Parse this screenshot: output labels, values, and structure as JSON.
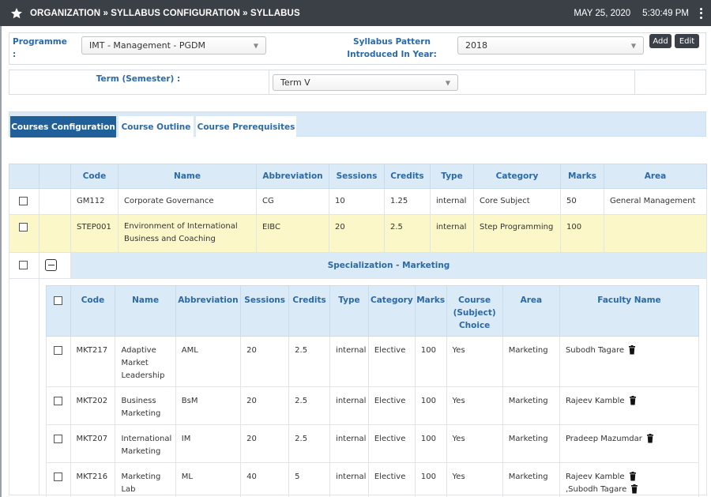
{
  "header": {
    "breadcrumb": "ORGANIZATION » SYLLABUS CONFIGURATION » SYLLABUS",
    "date": "MAY 25, 2020",
    "time": "5:30:49 PM"
  },
  "filters": {
    "programme_label": "Programme :",
    "programme_value": "IMT - Management - PGDM",
    "pattern_label": "Syllabus Pattern Introduced In Year:",
    "pattern_value": "2018",
    "add_label": "Add",
    "edit_label": "Edit",
    "term_label": "Term (Semester) :",
    "term_value": "Term V"
  },
  "tabs": [
    {
      "label": "Courses Configuration"
    },
    {
      "label": "Course Outline"
    },
    {
      "label": "Course Prerequisites"
    }
  ],
  "courses_table": {
    "headers": [
      "Code",
      "Name",
      "Abbreviation",
      "Sessions",
      "Credits",
      "Type",
      "Category",
      "Marks",
      "Area"
    ],
    "rows": [
      [
        "GM112",
        "Corporate Governance",
        "CG",
        "10",
        "1.25",
        "internal",
        "Core Subject",
        "50",
        "General Management"
      ],
      [
        "STEP001",
        "Environment of International Business and Coaching",
        "EIBC",
        "20",
        "2.5",
        "internal",
        "Step Programming",
        "100",
        ""
      ]
    ],
    "specialization_title": "Specialization - Marketing"
  },
  "specialization_table": {
    "headers": [
      "Code",
      "Name",
      "Abbreviation",
      "Sessions",
      "Credits",
      "Type",
      "Category",
      "Marks",
      "Course (Subject) Choice",
      "Area",
      "Faculty Name"
    ],
    "rows": [
      {
        "code": "MKT217",
        "name": "Adaptive Market Leadership",
        "abbr": "AML",
        "sessions": "20",
        "credits": "2.5",
        "type": "internal",
        "category": "Elective",
        "marks": "100",
        "choice": "Yes",
        "area": "Marketing",
        "faculty": [
          "Subodh Tagare"
        ]
      },
      {
        "code": "MKT202",
        "name": "Business Marketing",
        "abbr": "BsM",
        "sessions": "20",
        "credits": "2.5",
        "type": "internal",
        "category": "Elective",
        "marks": "100",
        "choice": "Yes",
        "area": "Marketing",
        "faculty": [
          "Rajeev Kamble"
        ]
      },
      {
        "code": "MKT207",
        "name": "International Marketing",
        "abbr": "IM",
        "sessions": "20",
        "credits": "2.5",
        "type": "internal",
        "category": "Elective",
        "marks": "100",
        "choice": "Yes",
        "area": "Marketing",
        "faculty": [
          "Pradeep Mazumdar"
        ]
      },
      {
        "code": "MKT216",
        "name": "Marketing Lab",
        "abbr": "ML",
        "sessions": "40",
        "credits": "5",
        "type": "internal",
        "category": "Elective",
        "marks": "100",
        "choice": "Yes",
        "area": "Marketing",
        "faculty": [
          "Rajeev Kamble",
          ",Subodh Tagare"
        ]
      }
    ]
  },
  "icons": {
    "star": "star-icon",
    "menu": "kebab-menu-icon",
    "collapse": "minus-square-icon",
    "delete": "trash-icon",
    "dropdown": "caret-down-icon"
  },
  "colors": {
    "topbar": "#3b3f46",
    "accent": "#2c6aa6",
    "active_tab": "#1f5f9a",
    "header_bg": "#dbeaf7",
    "highlight_row": "#fbf7c9"
  }
}
